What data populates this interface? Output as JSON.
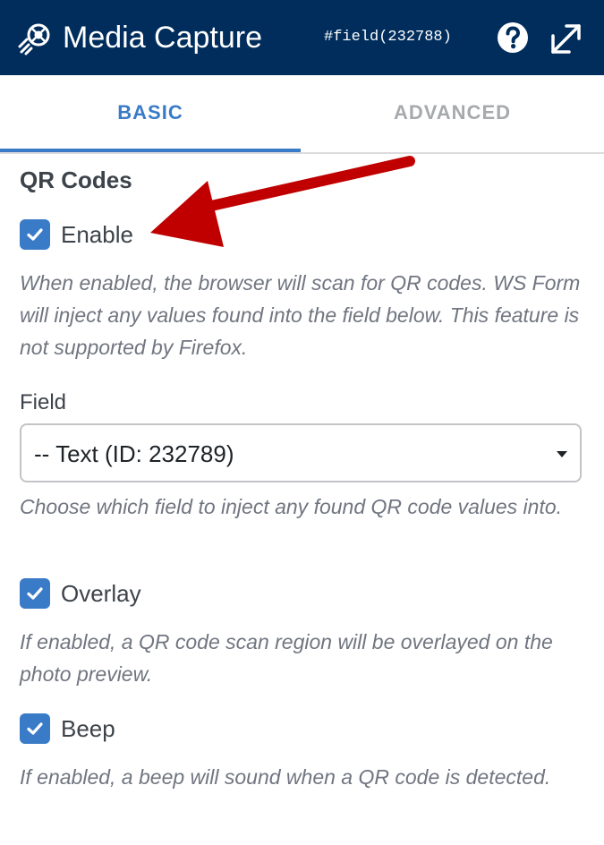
{
  "header": {
    "title": "Media Capture",
    "field_id": "#field(232788)",
    "logo_icon": "media-capture-logo-icon",
    "help_icon": "help-icon",
    "popout_icon": "popout-icon",
    "background_color": "#002d5c"
  },
  "tabs": [
    {
      "label": "BASIC",
      "active": true
    },
    {
      "label": "ADVANCED",
      "active": false
    }
  ],
  "accent_color": "#3a7bc8",
  "annotation_color": "#c00000",
  "section": {
    "title": "QR Codes",
    "enable": {
      "label": "Enable",
      "checked": true,
      "help": "When enabled, the browser will scan for QR codes. WS Form will inject any values found into the field below. This feature is not supported by Firefox."
    },
    "field": {
      "label": "Field",
      "selected": "-- Text (ID: 232789)",
      "help": "Choose which field to inject any found QR code values into."
    },
    "overlay": {
      "label": "Overlay",
      "checked": true,
      "help": "If enabled, a QR code scan region will be overlayed on the photo preview."
    },
    "beep": {
      "label": "Beep",
      "checked": true,
      "help": "If enabled, a beep will sound when a QR code is detected."
    }
  }
}
